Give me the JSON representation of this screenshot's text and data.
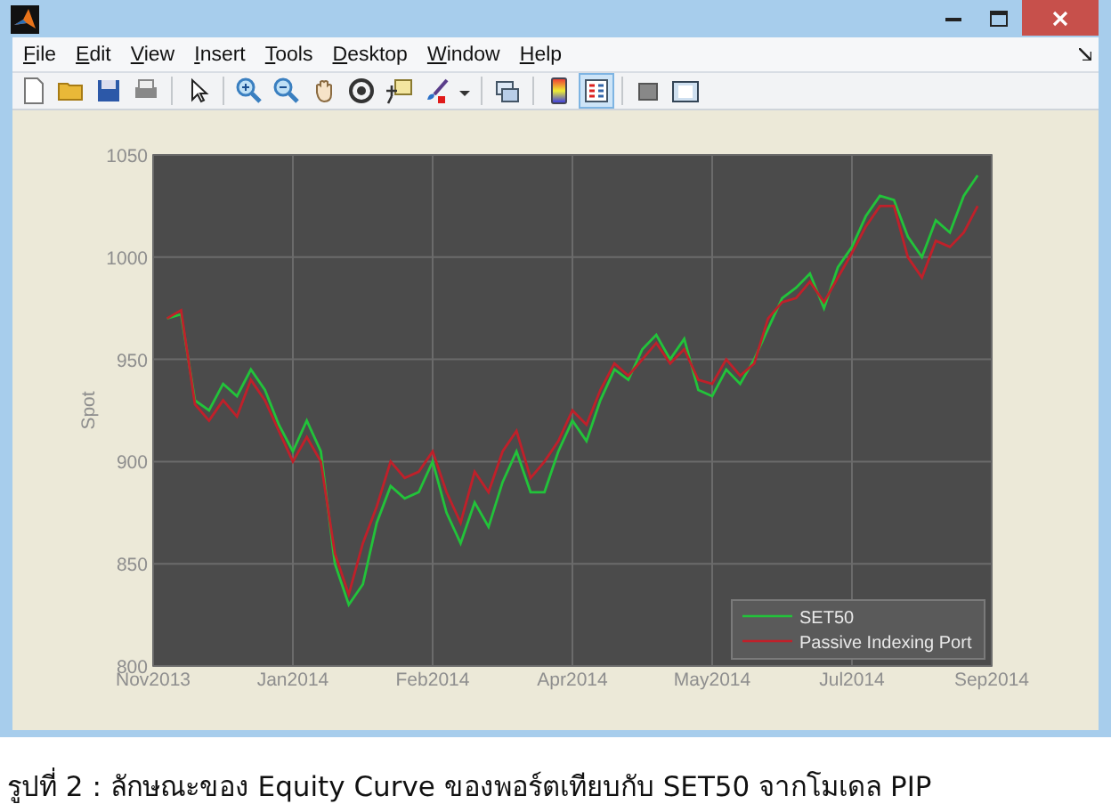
{
  "menu": [
    "File",
    "Edit",
    "View",
    "Insert",
    "Tools",
    "Desktop",
    "Window",
    "Help"
  ],
  "toolbar": [
    {
      "selected": false
    },
    {
      "selected": false
    },
    {
      "selected": false
    },
    {
      "selected": false
    },
    {
      "selected": false
    },
    {
      "selected": false
    },
    {
      "selected": false
    },
    {
      "selected": false
    },
    {
      "selected": false
    },
    {
      "selected": false
    },
    {
      "selected": false
    },
    {
      "selected": false
    },
    {
      "selected": false
    },
    {
      "selected": false
    },
    {
      "selected": true
    },
    {
      "selected": false
    },
    {
      "selected": false
    }
  ],
  "figure": {
    "chart_data": {
      "type": "line",
      "grid": true,
      "legend": "lower right",
      "ylabel": "Spot",
      "ylim": [
        800,
        1050
      ],
      "yticks": [
        800,
        850,
        900,
        950,
        1000,
        1050
      ],
      "categories": [
        "Nov2013",
        null,
        null,
        null,
        null,
        null,
        null,
        null,
        null,
        null,
        "Jan2014",
        null,
        null,
        null,
        null,
        null,
        null,
        null,
        null,
        null,
        "Feb2014",
        null,
        null,
        null,
        null,
        null,
        null,
        null,
        null,
        null,
        "Apr2014",
        null,
        null,
        null,
        null,
        null,
        null,
        null,
        null,
        null,
        "May2014",
        null,
        null,
        null,
        null,
        null,
        null,
        null,
        null,
        null,
        "Jul2014",
        null,
        null,
        null,
        null,
        null,
        null,
        null,
        null,
        null,
        "Sep2014"
      ],
      "series": [
        {
          "name": "SET50",
          "color": "#22c33a",
          "values": [
            null,
            970,
            972,
            930,
            925,
            938,
            932,
            945,
            935,
            918,
            905,
            920,
            905,
            850,
            830,
            840,
            870,
            888,
            882,
            885,
            900,
            875,
            860,
            880,
            868,
            890,
            905,
            885,
            885,
            905,
            920,
            910,
            930,
            945,
            940,
            955,
            962,
            950,
            960,
            935,
            932,
            945,
            938,
            950,
            965,
            980,
            985,
            992,
            975,
            995,
            1005,
            1020,
            1030,
            1028,
            1010,
            1000,
            1018,
            1012,
            1030,
            1040,
            null
          ]
        },
        {
          "name": "Passive Indexing Port",
          "color": "#c0202a",
          "values": [
            null,
            970,
            974,
            928,
            920,
            930,
            922,
            940,
            930,
            915,
            900,
            912,
            900,
            855,
            835,
            860,
            878,
            900,
            892,
            895,
            905,
            885,
            870,
            895,
            885,
            905,
            915,
            892,
            900,
            910,
            925,
            918,
            935,
            948,
            942,
            950,
            958,
            948,
            955,
            940,
            938,
            950,
            942,
            948,
            970,
            978,
            980,
            988,
            978,
            990,
            1002,
            1015,
            1025,
            1025,
            1000,
            990,
            1008,
            1005,
            1012,
            1025,
            null
          ]
        }
      ]
    }
  },
  "caption": "รูปที่ 2 : ลักษณะของ Equity Curve ของพอร์ตเทียบกับ SET50 จากโมเดล PIP"
}
